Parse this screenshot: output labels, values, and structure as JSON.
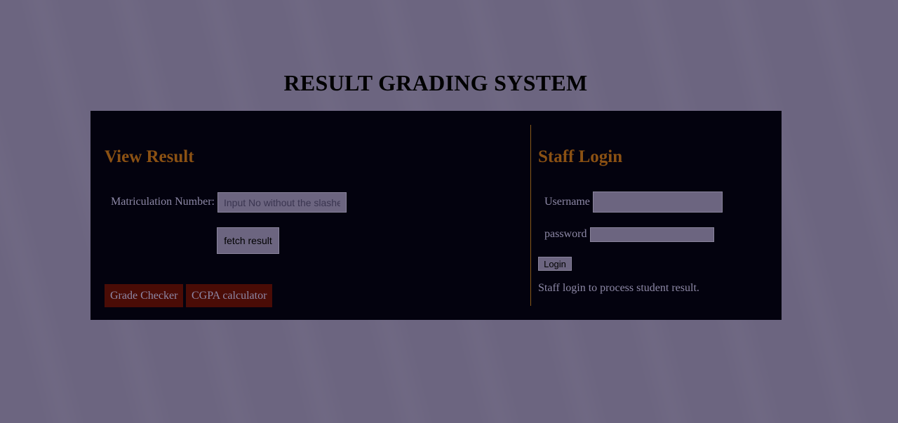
{
  "page": {
    "title": "RESULT GRADING SYSTEM"
  },
  "view_result": {
    "heading": "View Result",
    "matric_label": "Matriculation Number:",
    "matric_placeholder": "Input No without the slashes",
    "matric_value": "",
    "fetch_button": "fetch result",
    "links": [
      {
        "label": "Grade Checker"
      },
      {
        "label": "CGPA calculator"
      }
    ]
  },
  "staff_login": {
    "heading": "Staff Login",
    "username_label": "Username",
    "username_value": "",
    "password_label": "password",
    "password_value": "",
    "login_button": "Login",
    "note": "Staff login to process student result."
  },
  "colors": {
    "background": "#6c6580",
    "panel": "#03020e",
    "heading_accent": "#8b5113",
    "link_button_bg": "#4a0c06",
    "divider": "#8a5a1a"
  }
}
